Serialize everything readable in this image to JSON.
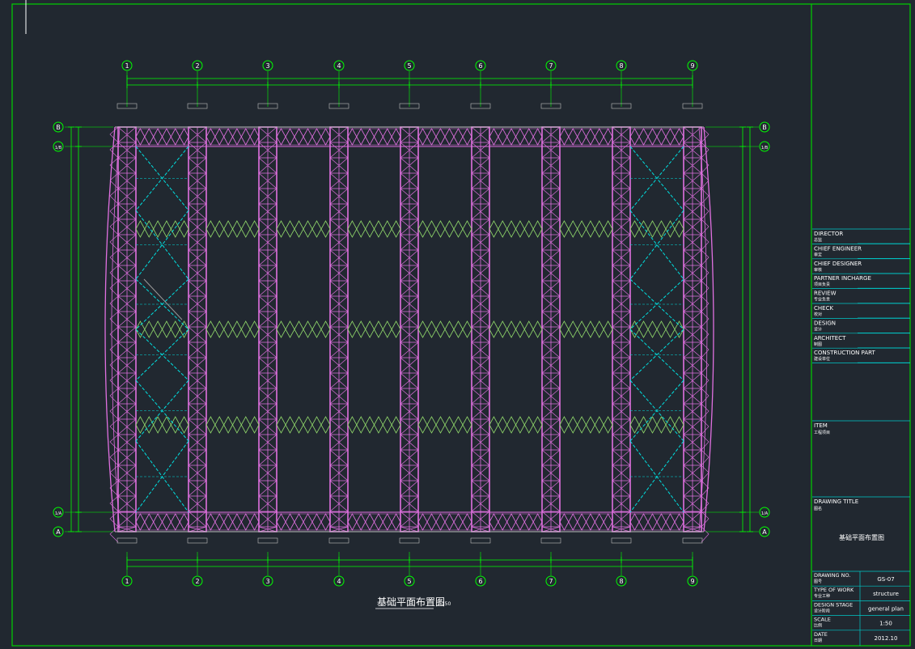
{
  "drawing": {
    "title_cn": "基础平面布置图",
    "scale_note": "1:150"
  },
  "grid": {
    "columns": [
      "1",
      "2",
      "3",
      "4",
      "5",
      "6",
      "7",
      "8",
      "9"
    ],
    "rows": [
      {
        "id": "row-B",
        "label": "B"
      },
      {
        "id": "row-B1",
        "label": "1/B"
      },
      {
        "id": "row-A1",
        "label": "1/A"
      },
      {
        "id": "row-A",
        "label": "A"
      }
    ]
  },
  "title_block": {
    "roles": [
      {
        "en": "DIRECTOR",
        "cn": "总监"
      },
      {
        "en": "CHIEF ENGINEER",
        "cn": "审定"
      },
      {
        "en": "CHIEF DESIGNER",
        "cn": "审核"
      },
      {
        "en": "PARTNER INCHARGE",
        "cn": "项目负责"
      },
      {
        "en": "REVIEW",
        "cn": "专业负责"
      },
      {
        "en": "CHECK",
        "cn": "校对"
      },
      {
        "en": "DESIGN",
        "cn": "设计"
      },
      {
        "en": "ARCHITECT",
        "cn": "制图"
      },
      {
        "en": "CONSTRUCTION PART",
        "cn": "建设单位"
      }
    ],
    "item": {
      "en": "ITEM",
      "cn": "工程项目"
    },
    "drawing_title": {
      "en": "DRAWING TITLE",
      "cn": "图名",
      "value": "基础平面布置图"
    },
    "info": [
      {
        "en": "DRAWING NO.",
        "cn": "图号",
        "value": "GS-07"
      },
      {
        "en": "TYPE OF WORK",
        "cn": "专业工种",
        "value": "structure"
      },
      {
        "en": "DESIGN STAGE",
        "cn": "设计阶段",
        "value": "general plan"
      },
      {
        "en": "SCALE",
        "cn": "比例",
        "value": "1:50"
      },
      {
        "en": "DATE",
        "cn": "日期",
        "value": "2012.10"
      }
    ]
  },
  "colors": {
    "background": "#212830",
    "frame": "#00d000",
    "dimension": "#00ff00",
    "truss": "#e070e0",
    "bracing": "#00e0e0",
    "text": "#ffffff",
    "title_block_line": "#00c8c8"
  }
}
